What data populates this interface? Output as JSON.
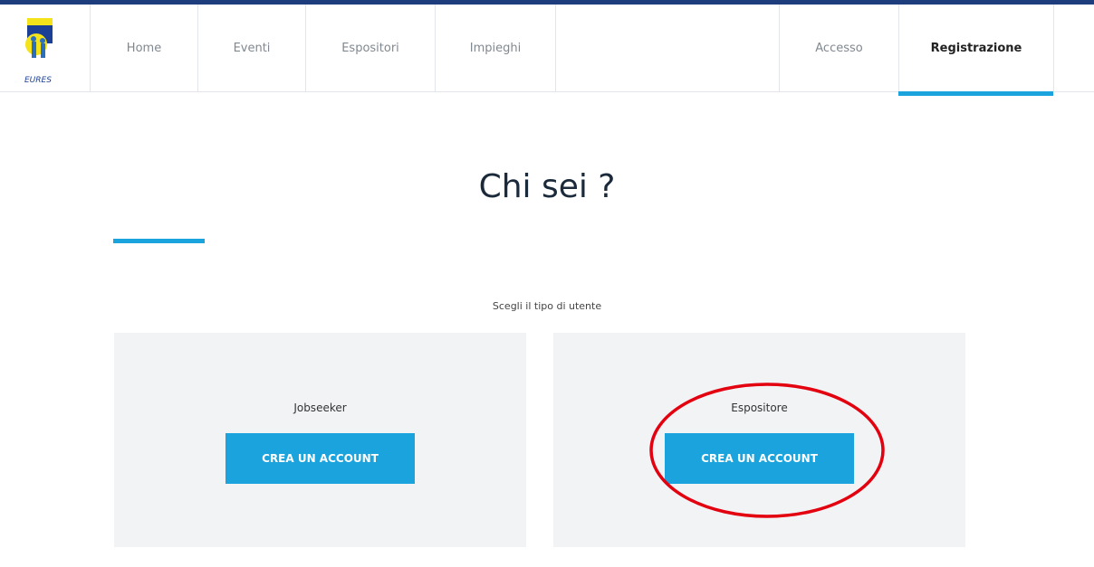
{
  "nav": {
    "logo_text": "EURES",
    "items": [
      {
        "label": "Home"
      },
      {
        "label": "Eventi"
      },
      {
        "label": "Espositori"
      },
      {
        "label": "Impieghi"
      },
      {
        "label": "Accesso"
      },
      {
        "label": "Registrazione"
      }
    ],
    "active": "Registrazione"
  },
  "main": {
    "title": "Chi sei ?",
    "subtitle": "Scegli il tipo di utente",
    "cards": [
      {
        "label": "Jobseeker",
        "button": "CREA UN ACCOUNT"
      },
      {
        "label": "Espositore",
        "button": "CREA UN ACCOUNT"
      }
    ]
  },
  "colors": {
    "accent": "#1aa3dd",
    "topbar": "#1d3d7d",
    "card_bg": "#f1f3f5",
    "annotation": "#e3000f"
  }
}
